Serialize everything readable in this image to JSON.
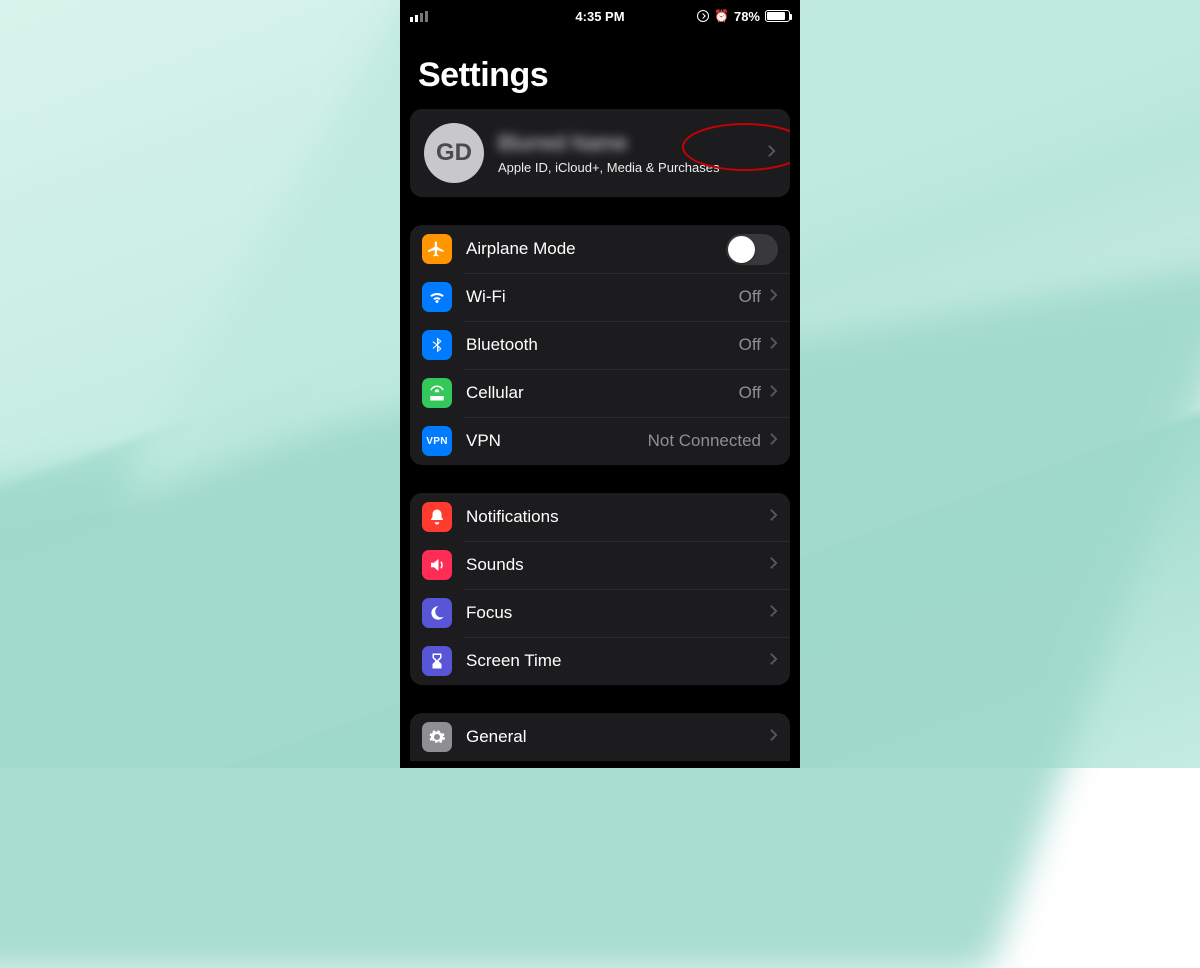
{
  "status": {
    "time": "4:35 PM",
    "battery_pct": "78%",
    "signal_active_bars": 2
  },
  "title": "Settings",
  "account": {
    "initials": "GD",
    "name_blurred": "Blurred Name",
    "subtitle": "Apple ID, iCloud+, Media & Purchases"
  },
  "group_connectivity": [
    {
      "key": "airplane",
      "label": "Airplane Mode",
      "type": "toggle",
      "value": "off",
      "icon_bg": "#ff9500"
    },
    {
      "key": "wifi",
      "label": "Wi-Fi",
      "type": "link",
      "value": "Off",
      "icon_bg": "#007aff"
    },
    {
      "key": "bluetooth",
      "label": "Bluetooth",
      "type": "link",
      "value": "Off",
      "icon_bg": "#007aff"
    },
    {
      "key": "cellular",
      "label": "Cellular",
      "type": "link",
      "value": "Off",
      "icon_bg": "#34c759"
    },
    {
      "key": "vpn",
      "label": "VPN",
      "type": "link",
      "value": "Not Connected",
      "icon_bg": "#007aff"
    }
  ],
  "group_notifications": [
    {
      "key": "notifications",
      "label": "Notifications",
      "icon_bg": "#ff3b30"
    },
    {
      "key": "sounds",
      "label": "Sounds",
      "icon_bg": "#ff2d55"
    },
    {
      "key": "focus",
      "label": "Focus",
      "icon_bg": "#5856d6"
    },
    {
      "key": "screentime",
      "label": "Screen Time",
      "icon_bg": "#5856d6"
    }
  ],
  "group_general": [
    {
      "key": "general",
      "label": "General",
      "icon_bg": "#8e8e93"
    }
  ],
  "annotation": {
    "shape": "ellipse",
    "color": "#cc0000",
    "target": "account-chevron"
  }
}
